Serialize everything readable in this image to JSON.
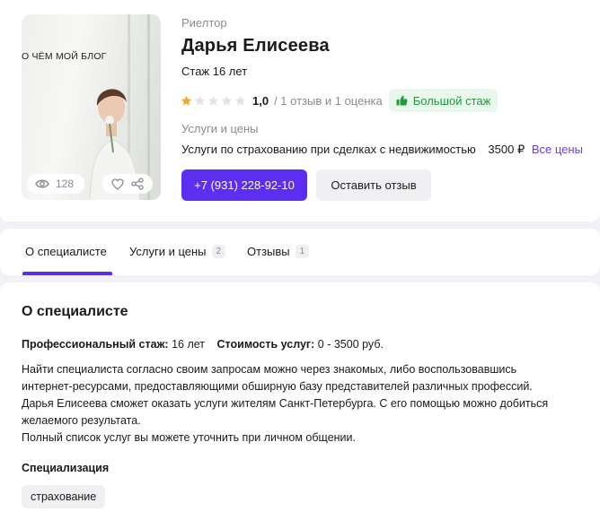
{
  "profile": {
    "photo_caption": "О ЧЁМ МОЙ БЛОГ",
    "views": "128",
    "role": "Риелтор",
    "name": "Дарья Елисеева",
    "experience": "Стаж 16 лет",
    "rating": {
      "stars_filled": 1,
      "stars_total": 5,
      "value": "1,0",
      "reviews_text": "/ 1 отзыв и 1 оценка",
      "badge": "Большой стаж"
    },
    "services": {
      "title": "Услуги и цены",
      "item": "Услуги по страхованию при сделках с недвижимостью",
      "price": "3500 ₽",
      "all_link": "Все цены"
    },
    "phone_button": "+7 (931) 228-92-10",
    "review_button": "Оставить отзыв"
  },
  "tabs": [
    {
      "label": "О специалисте",
      "count": ""
    },
    {
      "label": "Услуги и цены",
      "count": "2"
    },
    {
      "label": "Отзывы",
      "count": "1"
    }
  ],
  "about": {
    "title": "О специалисте",
    "exp_label": "Профессиональный стаж:",
    "exp_value": "16 лет",
    "cost_label": "Стоимость услуг:",
    "cost_value": "0 - 3500 руб.",
    "description": [
      "Найти специалиста согласно своим запросам можно через знакомых, либо воспользовавшись интернет-ресурсами, предоставляющими обширную базу представителей различных профессий.",
      "Дарья Елисеева сможет оказать услуги жителям Санкт-Петербурга. С его помощью можно добиться желаемого результата.",
      "Полный список услуг вы можете уточнить при личном общении."
    ],
    "specialization_title": "Специализация",
    "specialization_tag": "страхование"
  },
  "colors": {
    "accent": "#5b2ef0",
    "star": "#f5a623",
    "badge_green": "#1f9a3c"
  }
}
